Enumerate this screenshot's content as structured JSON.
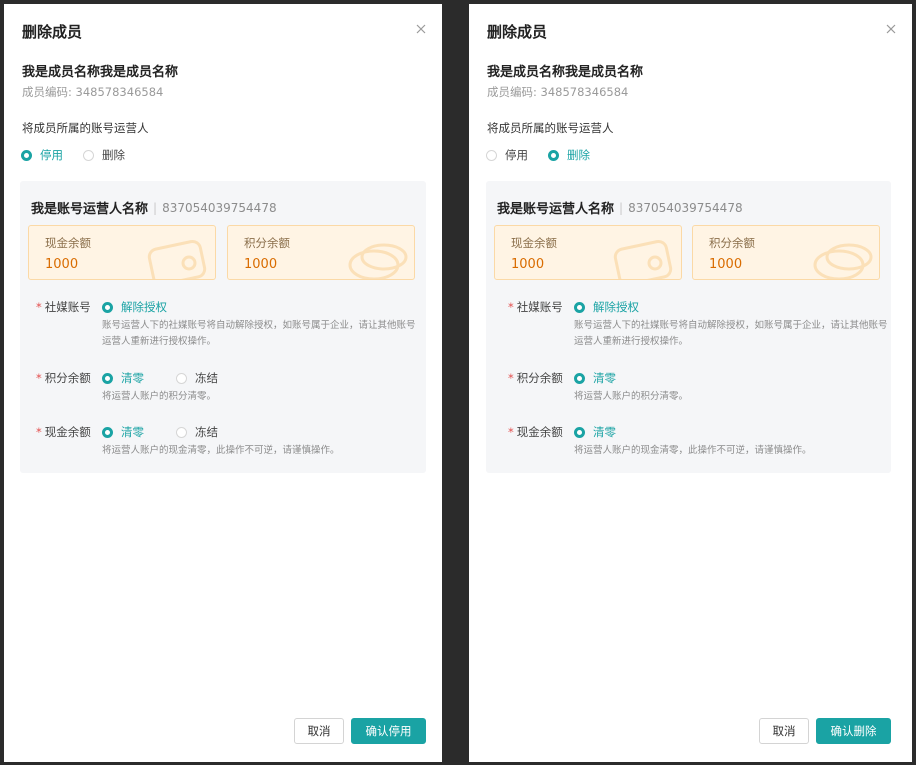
{
  "colors": {
    "accent": "#1aa3a4",
    "required": "#e34d4d",
    "balance_value": "#d96c00",
    "balance_bg": "#fff4e4"
  },
  "dialogs": [
    {
      "title": "删除成员",
      "member_name": "我是成员名称我是成员名称",
      "member_code_label": "成员编码:",
      "member_code": "348578346584",
      "question": "将成员所属的账号运营人",
      "options": [
        {
          "label": "停用",
          "checked": true
        },
        {
          "label": "删除",
          "checked": false
        }
      ],
      "operator_name": "我是账号运营人名称",
      "operator_id": "837054039754478",
      "cash_label": "现金余额",
      "cash_value": "1000",
      "points_label": "积分余额",
      "points_value": "1000",
      "social_label": "社媒账号",
      "social_option": "解除授权",
      "social_hint": "账号运营人下的社媒账号将自动解除授权，如账号属于企业，请让其他账号运营人重新进行授权操作。",
      "points_field_label": "积分余额",
      "points_option_clear": "清零",
      "points_option_freeze": "冻结",
      "points_hint": "将运营人账户的积分清零。",
      "cash_field_label": "现金余额",
      "cash_option_clear": "清零",
      "cash_option_freeze": "冻结",
      "cash_hint": "将运营人账户的现金清零，此操作不可逆，请谨慎操作。",
      "cancel_label": "取消",
      "confirm_label": "确认停用"
    },
    {
      "title": "删除成员",
      "member_name": "我是成员名称我是成员名称",
      "member_code_label": "成员编码:",
      "member_code": "348578346584",
      "question": "将成员所属的账号运营人",
      "options": [
        {
          "label": "停用",
          "checked": false
        },
        {
          "label": "删除",
          "checked": true
        }
      ],
      "operator_name": "我是账号运营人名称",
      "operator_id": "837054039754478",
      "cash_label": "现金余额",
      "cash_value": "1000",
      "points_label": "积分余额",
      "points_value": "1000",
      "social_label": "社媒账号",
      "social_option": "解除授权",
      "social_hint": "账号运营人下的社媒账号将自动解除授权，如账号属于企业，请让其他账号运营人重新进行授权操作。",
      "points_field_label": "积分余额",
      "points_option_clear": "清零",
      "points_hint": "将运营人账户的积分清零。",
      "cash_field_label": "现金余额",
      "cash_option_clear": "清零",
      "cash_hint": "将运营人账户的现金清零，此操作不可逆，请谨慎操作。",
      "cancel_label": "取消",
      "confirm_label": "确认删除"
    }
  ]
}
